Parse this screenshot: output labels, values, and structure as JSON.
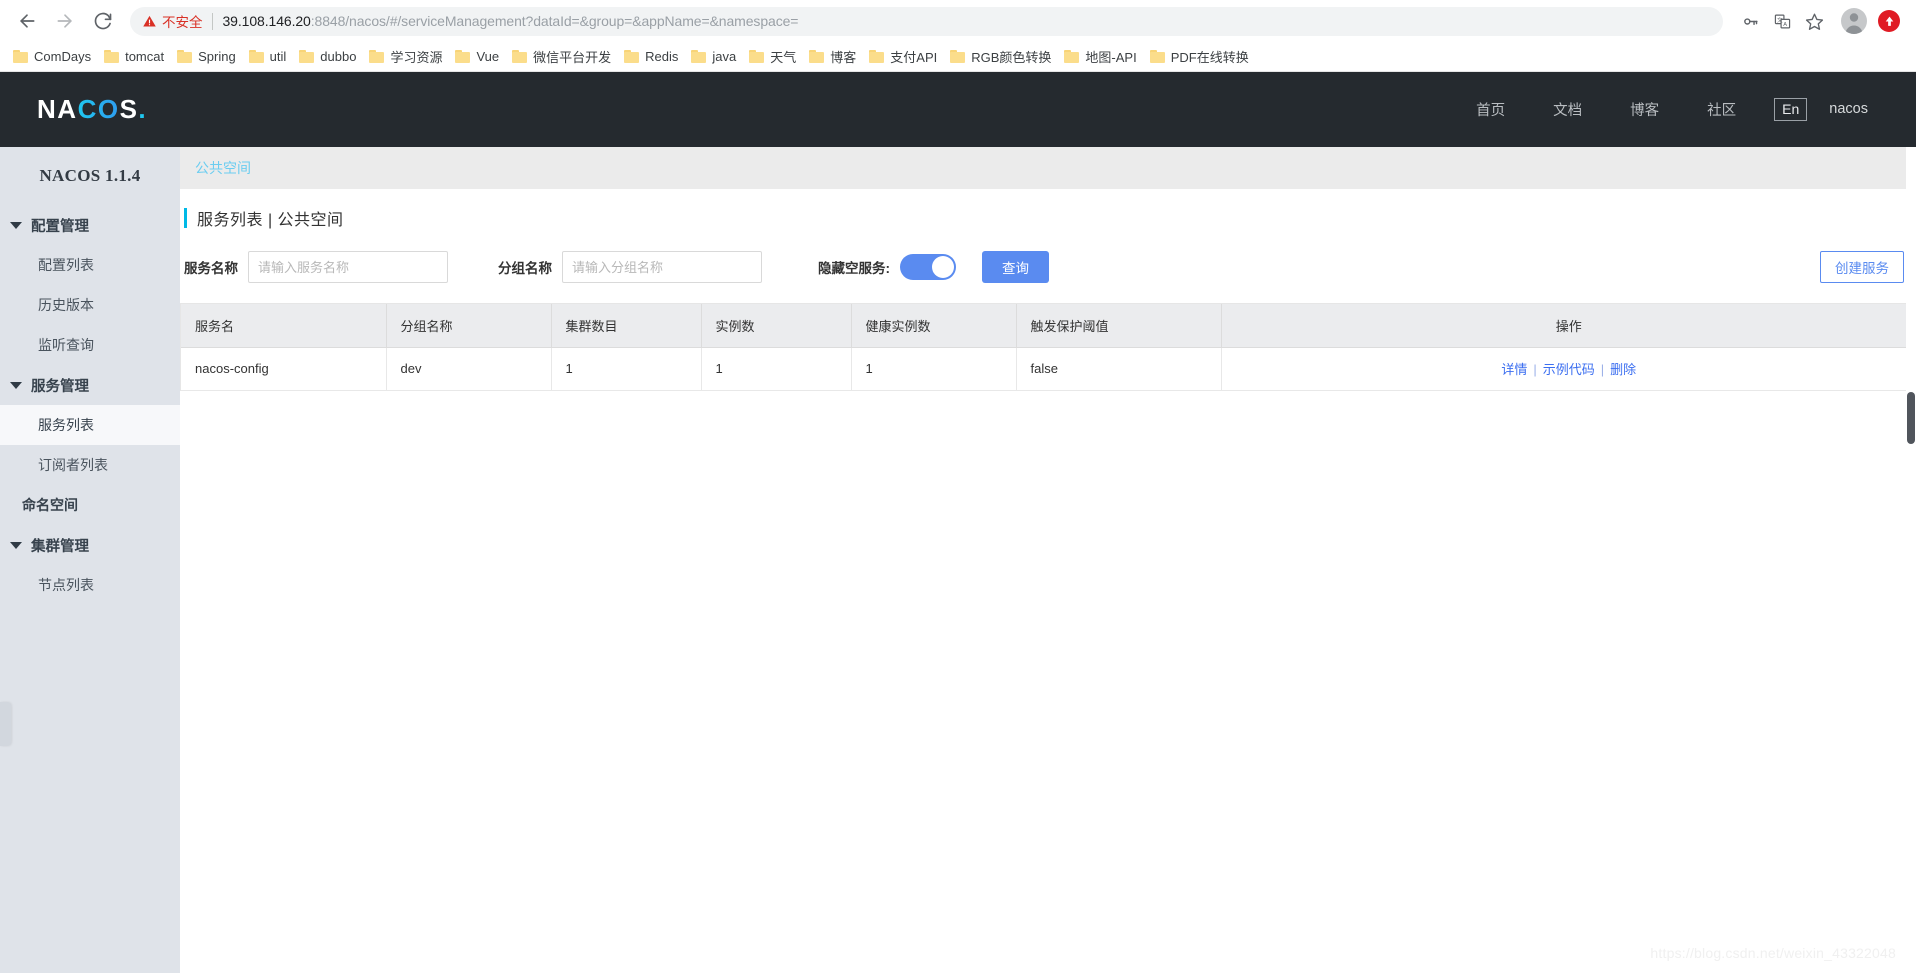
{
  "browser": {
    "back_icon": "back-arrow-icon",
    "forward_icon": "forward-arrow-icon",
    "reload_icon": "reload-icon",
    "security_label": "不安全",
    "url_host": "39.108.146.20",
    "url_rest": ":8848/nacos/#/serviceManagement?dataId=&group=&appName=&namespace=",
    "omni_icons": [
      "password-key-icon",
      "translate-icon",
      "bookmark-star-icon"
    ],
    "avatar_icon": "profile-avatar-icon",
    "extension_icon": "extension-icon",
    "bookmarks": [
      {
        "label": "ComDays"
      },
      {
        "label": "tomcat"
      },
      {
        "label": "Spring"
      },
      {
        "label": "util"
      },
      {
        "label": "dubbo"
      },
      {
        "label": "学习资源"
      },
      {
        "label": "Vue"
      },
      {
        "label": "微信平台开发"
      },
      {
        "label": "Redis"
      },
      {
        "label": "java"
      },
      {
        "label": "天气"
      },
      {
        "label": "博客"
      },
      {
        "label": "支付API"
      },
      {
        "label": "RGB颜色转换"
      },
      {
        "label": "地图-API"
      },
      {
        "label": "PDF在线转换"
      }
    ]
  },
  "app_header": {
    "logo_part1": "NA",
    "logo_part2": "CO",
    "logo_part3": "S",
    "logo_dot": ".",
    "nav": [
      {
        "label": "首页"
      },
      {
        "label": "文档"
      },
      {
        "label": "博客"
      },
      {
        "label": "社区"
      }
    ],
    "lang_toggle": "En",
    "user": "nacos"
  },
  "sidebar": {
    "version_title": "NACOS 1.1.4",
    "groups": [
      {
        "label": "配置管理",
        "items": [
          {
            "label": "配置列表",
            "active": false
          },
          {
            "label": "历史版本",
            "active": false
          },
          {
            "label": "监听查询",
            "active": false
          }
        ]
      },
      {
        "label": "服务管理",
        "items": [
          {
            "label": "服务列表",
            "active": true
          },
          {
            "label": "订阅者列表",
            "active": false
          }
        ]
      }
    ],
    "standalone_item": "命名空间",
    "cluster_group": {
      "label": "集群管理",
      "items": [
        {
          "label": "节点列表",
          "active": false
        }
      ]
    }
  },
  "content": {
    "breadcrumb": "公共空间",
    "page_title": "服务列表  |  公共空间",
    "filters": {
      "service_name_label": "服务名称",
      "service_name_value": "",
      "service_name_placeholder": "请输入服务名称",
      "group_name_label": "分组名称",
      "group_name_value": "",
      "group_name_placeholder": "请输入分组名称",
      "hide_empty_label": "隐藏空服务:",
      "hide_empty_on": true,
      "query_button": "查询",
      "create_button": "创建服务"
    },
    "table": {
      "columns": [
        "服务名",
        "分组名称",
        "集群数目",
        "实例数",
        "健康实例数",
        "触发保护阈值",
        "操作"
      ],
      "rows": [
        {
          "service_name": "nacos-config",
          "group_name": "dev",
          "cluster_count": "1",
          "instance_count": "1",
          "healthy_instance_count": "1",
          "protect_threshold": "false",
          "actions": [
            "详情",
            "示例代码",
            "删除"
          ],
          "action_separator": "|"
        }
      ]
    },
    "watermark": "https://blog.csdn.net/weixin_43322048"
  }
}
